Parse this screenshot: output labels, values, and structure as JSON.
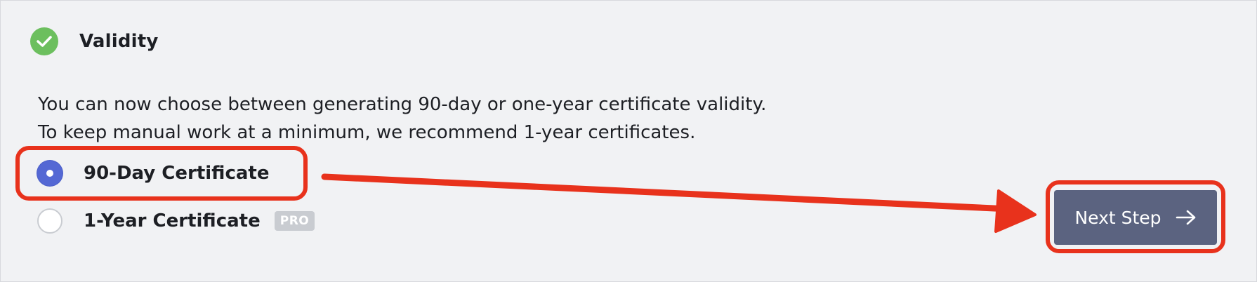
{
  "section": {
    "title": "Validity",
    "status_icon": "check-circle-icon",
    "description_lines": [
      "You can now choose between generating 90-day or one-year certificate validity.",
      "To keep manual work at a minimum, we recommend 1-year certificates."
    ]
  },
  "options": [
    {
      "label": "90-Day Certificate",
      "selected": true
    },
    {
      "label": "1-Year Certificate",
      "selected": false,
      "badge": "PRO"
    }
  ],
  "next_button": {
    "label": "Next Step",
    "icon": "arrow-right-icon"
  },
  "colors": {
    "accent": "#5468d4",
    "success": "#6cbf5e",
    "button": "#5b6380",
    "annotation": "#e8321c"
  }
}
